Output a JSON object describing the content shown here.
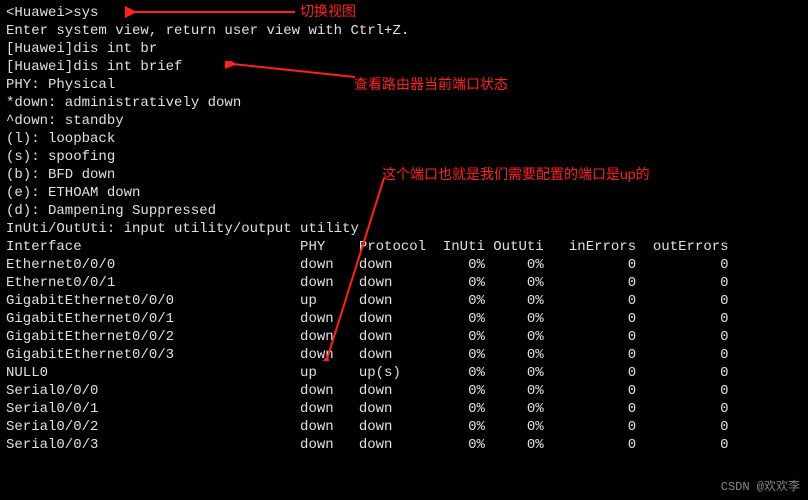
{
  "lines": {
    "l0": "<Huawei>sys",
    "l1": "Enter system view, return user view with Ctrl+Z.",
    "l2": "[Huawei]dis int br",
    "l3": "[Huawei]dis int brief",
    "l4": "PHY: Physical",
    "l5": "*down: administratively down",
    "l6": "^down: standby",
    "l7": "(l): loopback",
    "l8": "(s): spoofing",
    "l9": "(b): BFD down",
    "l10": "(e): ETHOAM down",
    "l11": "(d): Dampening Suppressed",
    "l12": "InUti/OutUti: input utility/output utility"
  },
  "header": {
    "iface": "Interface",
    "phy": "PHY",
    "proto": "Protocol",
    "inuti": "InUti",
    "oututi": "OutUti",
    "inerr": "inErrors",
    "outerr": "outErrors"
  },
  "rows": [
    {
      "iface": "Ethernet0/0/0",
      "phy": "down",
      "proto": "down",
      "inuti": "0%",
      "oututi": "0%",
      "inerr": "0",
      "outerr": "0"
    },
    {
      "iface": "Ethernet0/0/1",
      "phy": "down",
      "proto": "down",
      "inuti": "0%",
      "oututi": "0%",
      "inerr": "0",
      "outerr": "0"
    },
    {
      "iface": "GigabitEthernet0/0/0",
      "phy": "up",
      "proto": "down",
      "inuti": "0%",
      "oututi": "0%",
      "inerr": "0",
      "outerr": "0"
    },
    {
      "iface": "GigabitEthernet0/0/1",
      "phy": "down",
      "proto": "down",
      "inuti": "0%",
      "oututi": "0%",
      "inerr": "0",
      "outerr": "0"
    },
    {
      "iface": "GigabitEthernet0/0/2",
      "phy": "down",
      "proto": "down",
      "inuti": "0%",
      "oututi": "0%",
      "inerr": "0",
      "outerr": "0"
    },
    {
      "iface": "GigabitEthernet0/0/3",
      "phy": "down",
      "proto": "down",
      "inuti": "0%",
      "oututi": "0%",
      "inerr": "0",
      "outerr": "0"
    },
    {
      "iface": "NULL0",
      "phy": "up",
      "proto": "up(s)",
      "inuti": "0%",
      "oututi": "0%",
      "inerr": "0",
      "outerr": "0"
    },
    {
      "iface": "Serial0/0/0",
      "phy": "down",
      "proto": "down",
      "inuti": "0%",
      "oututi": "0%",
      "inerr": "0",
      "outerr": "0"
    },
    {
      "iface": "Serial0/0/1",
      "phy": "down",
      "proto": "down",
      "inuti": "0%",
      "oututi": "0%",
      "inerr": "0",
      "outerr": "0"
    },
    {
      "iface": "Serial0/0/2",
      "phy": "down",
      "proto": "down",
      "inuti": "0%",
      "oututi": "0%",
      "inerr": "0",
      "outerr": "0"
    },
    {
      "iface": "Serial0/0/3",
      "phy": "down",
      "proto": "down",
      "inuti": "0%",
      "oututi": "0%",
      "inerr": "0",
      "outerr": "0"
    }
  ],
  "annotations": {
    "a1": "切换视图",
    "a2": "查看路由器当前端口状态",
    "a3": "这个端口也就是我们需要配置的端口是up的"
  },
  "watermark": "CSDN @欢欢李",
  "chart_data": {
    "type": "table",
    "title": "Interface brief",
    "columns": [
      "Interface",
      "PHY",
      "Protocol",
      "InUti",
      "OutUti",
      "inErrors",
      "outErrors"
    ],
    "rows": [
      [
        "Ethernet0/0/0",
        "down",
        "down",
        "0%",
        "0%",
        0,
        0
      ],
      [
        "Ethernet0/0/1",
        "down",
        "down",
        "0%",
        "0%",
        0,
        0
      ],
      [
        "GigabitEthernet0/0/0",
        "up",
        "down",
        "0%",
        "0%",
        0,
        0
      ],
      [
        "GigabitEthernet0/0/1",
        "down",
        "down",
        "0%",
        "0%",
        0,
        0
      ],
      [
        "GigabitEthernet0/0/2",
        "down",
        "down",
        "0%",
        "0%",
        0,
        0
      ],
      [
        "GigabitEthernet0/0/3",
        "down",
        "down",
        "0%",
        "0%",
        0,
        0
      ],
      [
        "NULL0",
        "up",
        "up(s)",
        "0%",
        "0%",
        0,
        0
      ],
      [
        "Serial0/0/0",
        "down",
        "down",
        "0%",
        "0%",
        0,
        0
      ],
      [
        "Serial0/0/1",
        "down",
        "down",
        "0%",
        "0%",
        0,
        0
      ],
      [
        "Serial0/0/2",
        "down",
        "down",
        "0%",
        "0%",
        0,
        0
      ],
      [
        "Serial0/0/3",
        "down",
        "down",
        "0%",
        "0%",
        0,
        0
      ]
    ]
  }
}
